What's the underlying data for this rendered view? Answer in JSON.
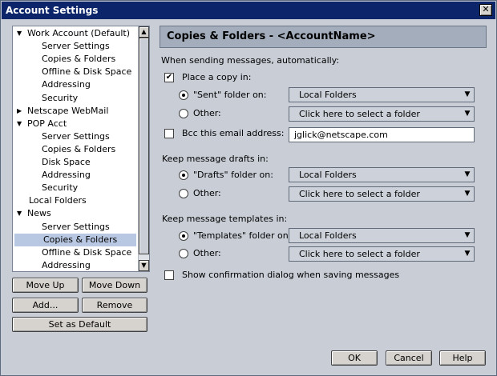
{
  "window": {
    "title": "Account Settings",
    "close_glyph": "✕"
  },
  "tree": {
    "items": [
      {
        "label": "Work Account (Default)",
        "twisty": "▼"
      },
      {
        "label": "Server Settings"
      },
      {
        "label": "Copies & Folders"
      },
      {
        "label": "Offline & Disk Space"
      },
      {
        "label": "Addressing"
      },
      {
        "label": "Security"
      },
      {
        "label": "Netscape WebMail",
        "twisty": "▶"
      },
      {
        "label": "POP Acct",
        "twisty": "▼"
      },
      {
        "label": "Server Settings"
      },
      {
        "label": "Copies & Folders"
      },
      {
        "label": "Disk Space"
      },
      {
        "label": "Addressing"
      },
      {
        "label": "Security"
      },
      {
        "label": "Local Folders"
      },
      {
        "label": "News",
        "twisty": "▼"
      },
      {
        "label": "Server Settings"
      },
      {
        "label": "Copies & Folders",
        "selected": true
      },
      {
        "label": "Offline & Disk Space"
      },
      {
        "label": "Addressing"
      }
    ]
  },
  "buttons": {
    "move_up": "Move Up",
    "move_down": "Move Down",
    "add": "Add...",
    "remove": "Remove",
    "set_default": "Set as Default",
    "ok": "OK",
    "cancel": "Cancel",
    "help": "Help"
  },
  "panel": {
    "title": "Copies & Folders - <AccountName>",
    "sending_label": "When sending messages, automatically:",
    "place_copy": "Place a copy in:",
    "sent_folder_on": "\"Sent\" folder on:",
    "other": "Other:",
    "bcc": "Bcc this email address:",
    "bcc_value": "jglick@netscape.com",
    "drafts_label": "Keep message drafts in:",
    "drafts_folder_on": "\"Drafts\" folder on:",
    "templates_label": "Keep message templates in:",
    "templates_folder_on": "\"Templates\" folder on:",
    "confirm_dialog": "Show confirmation dialog when saving messages",
    "local_folders": "Local Folders",
    "select_folder": "Click here to select a folder"
  }
}
